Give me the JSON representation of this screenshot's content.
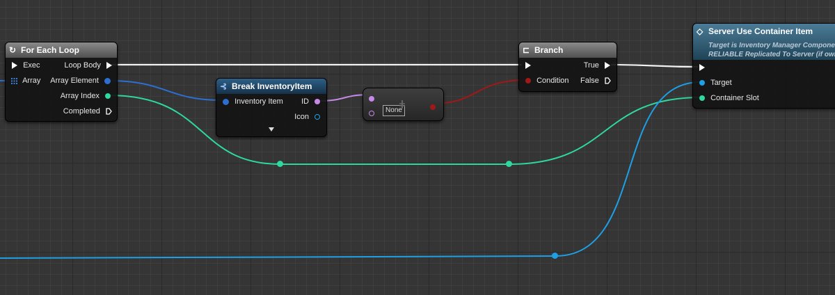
{
  "nodes": {
    "for_each": {
      "title": "For Each Loop",
      "pins": {
        "exec": "Exec",
        "array": "Array",
        "loop_body": "Loop Body",
        "array_element": "Array Element",
        "array_index": "Array Index",
        "completed": "Completed"
      }
    },
    "break": {
      "title": "Break InventoryItem",
      "pins": {
        "inventory_item": "Inventory Item",
        "id": "ID",
        "icon": "Icon"
      }
    },
    "equal": {
      "value": "None"
    },
    "branch": {
      "title": "Branch",
      "pins": {
        "condition": "Condition",
        "true": "True",
        "false": "False"
      }
    },
    "server": {
      "title": "Server Use Container Item",
      "subtitle1": "Target is Inventory Manager Componen",
      "subtitle2": "RELIABLE Replicated To Server (if own",
      "pins": {
        "target": "Target",
        "container_slot": "Container Slot"
      }
    }
  },
  "colors": {
    "exec": "#ffffff",
    "object": "#1da0e6",
    "struct": "#2d6fd1",
    "integer": "#2ed8a0",
    "name": "#c58ae8",
    "boolean": "#a01818",
    "background": "#353535"
  }
}
